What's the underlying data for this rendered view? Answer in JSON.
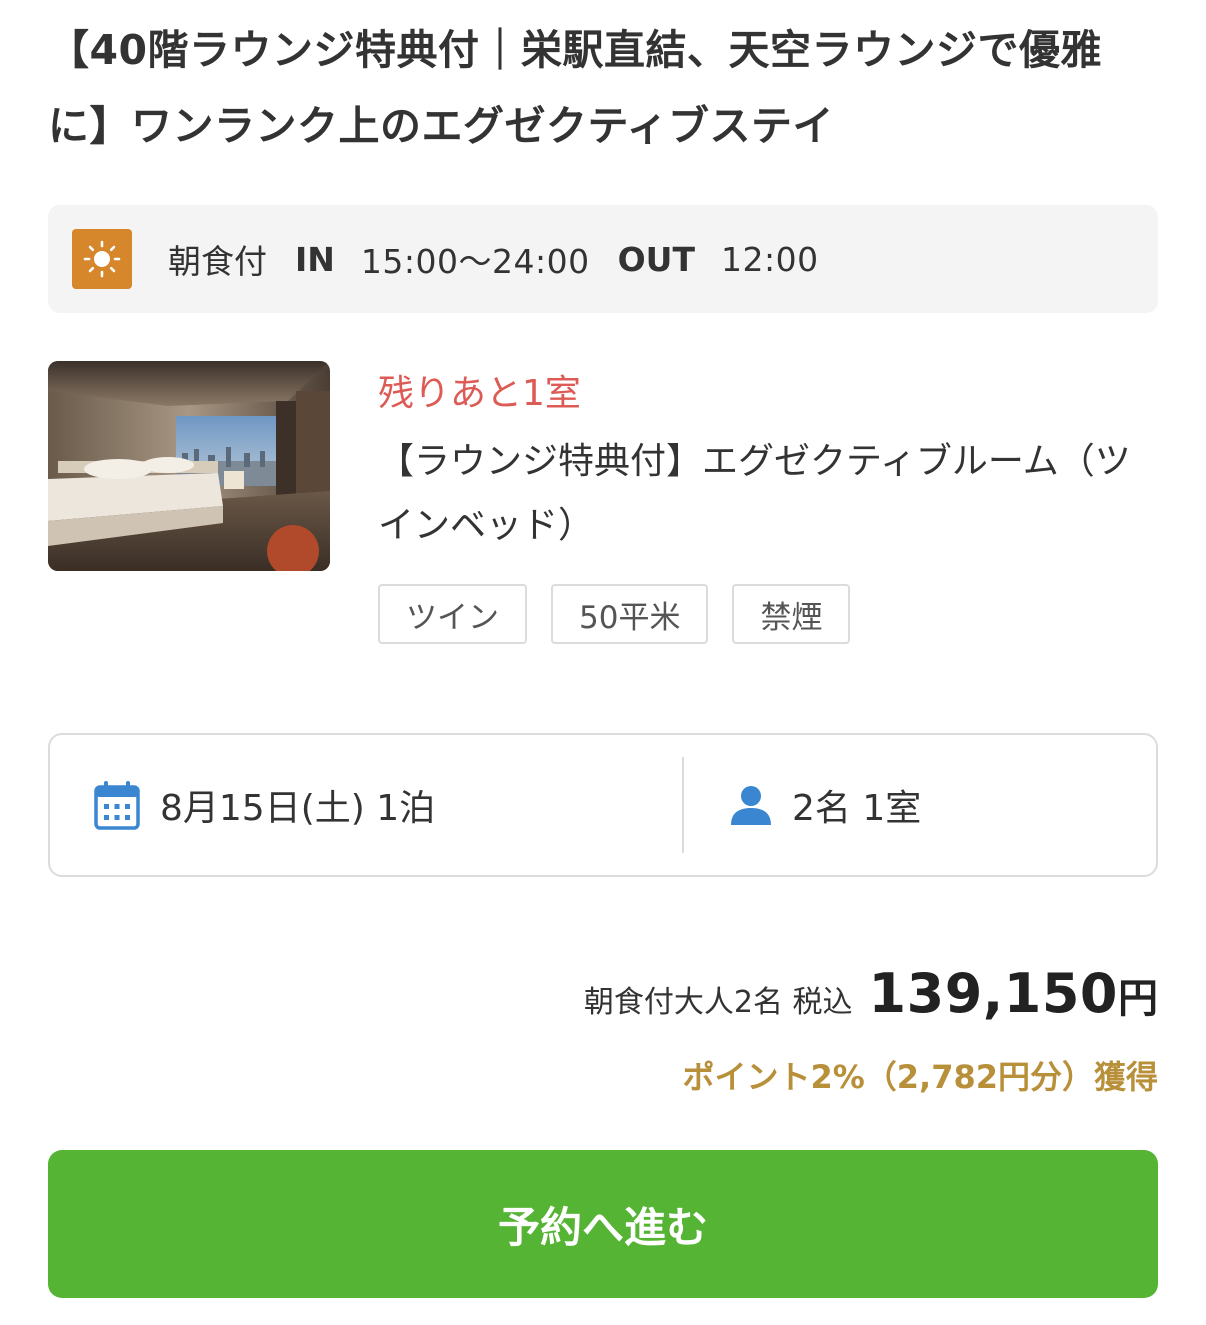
{
  "plan": {
    "title": "【40階ラウンジ特典付｜栄駅直結、天空ラウンジで優雅に】ワンランク上のエグゼクティブステイ"
  },
  "info": {
    "icon": "sun-icon",
    "icon_color": "#d6862b",
    "meal": "朝食付",
    "checkin_label": "IN",
    "checkin_time": "15:00〜24:00",
    "checkout_label": "OUT",
    "checkout_time": "12:00"
  },
  "room": {
    "remaining": "残りあと1室",
    "remaining_color": "#dd5b55",
    "name": "【ラウンジ特典付】エグゼクティブルーム（ツインベッド）",
    "tags": [
      "ツイン",
      "50平米",
      "禁煙"
    ]
  },
  "search": {
    "date_icon": "calendar-icon",
    "date": "8月15日(土) 1泊",
    "guest_icon": "person-icon",
    "guests": "2名 1室",
    "icon_color": "#3a86d1"
  },
  "price": {
    "label": "朝食付大人2名 税込",
    "amount": "139,150",
    "unit": "円",
    "points": "ポイント2%（2,782円分）獲得",
    "points_color": "#b8903a"
  },
  "action": {
    "reserve_label": "予約へ進む",
    "button_color": "#56b435"
  }
}
